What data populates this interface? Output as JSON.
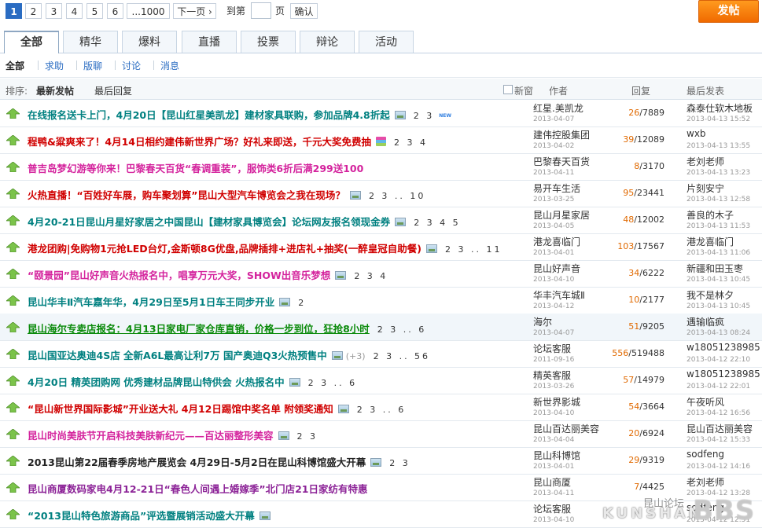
{
  "colors": {
    "accent": "#2a6cc2",
    "post_button": "#f47a0a",
    "teal": "#008080",
    "red": "#d00000",
    "pink": "#d4239d",
    "green": "#0a8a0a",
    "black": "#222222",
    "purple": "#8c2397",
    "reply_count": "#e06900"
  },
  "pagination": {
    "pages": [
      "1",
      "2",
      "3",
      "4",
      "5",
      "6",
      "...1000"
    ],
    "current": "1",
    "next_label": "下一页 ›",
    "goto_label": "到第",
    "page_suffix": "页",
    "confirm_label": "确认",
    "post_button": "发帖"
  },
  "tabs": [
    "全部",
    "精华",
    "爆料",
    "直播",
    "投票",
    "辩论",
    "活动"
  ],
  "active_tab": "全部",
  "subnav": [
    "全部",
    "求助",
    "版聊",
    "讨论",
    "消息"
  ],
  "header": {
    "sort_label": "排序:",
    "sort_latest_post": "最新发帖",
    "sort_last_reply": "最后回复",
    "new_window": "新窗",
    "author": "作者",
    "replies": "回复",
    "last_post": "最后发表"
  },
  "threads": [
    {
      "title": "在线报名送卡上门，4月20日【昆山红星美凯龙】建材家具联购，参加品牌4.8折起",
      "color": "teal",
      "img": true,
      "pages": "2 3",
      "new": "NEW",
      "author": "红星.美凯龙",
      "author_date": "2013-04-07",
      "replies": "26",
      "views": "/7889",
      "last_user": "森泰仕软木地板",
      "last_date": "2013-04-13 15:52"
    },
    {
      "title": "程鸭&粱爽来了！4月14日相约建伟新世界广场？好礼来即送，千元大奖免费抽",
      "color": "red",
      "book": true,
      "pages": "2 3 4",
      "author": "建伟控股集团",
      "author_date": "2013-04-02",
      "replies": "39",
      "views": "/12089",
      "last_user": "wxb",
      "last_date": "2013-04-13 13:55"
    },
    {
      "title": "普吉岛梦幻游等你来！巴黎春天百货“春调重装”，服饰类6折后满299送100",
      "color": "pink",
      "author": "巴黎春天百货",
      "author_date": "2013-04-11",
      "replies": "8",
      "views": "/3170",
      "last_user": "老刘老师",
      "last_date": "2013-04-13 13:23"
    },
    {
      "title": "火热直播！“百姓好车展，购车聚划算”昆山大型汽车博览会之我在现场？",
      "color": "red",
      "img": true,
      "pages": "2 3 .. 10",
      "author": "易开车生活",
      "author_date": "2013-03-25",
      "replies": "95",
      "views": "/23441",
      "last_user": "片刻安宁",
      "last_date": "2013-04-13 12:58"
    },
    {
      "title": "4月20-21日昆山月星好家居之中国昆山【建材家具博览会】论坛网友报名领现金券",
      "color": "teal",
      "img": true,
      "pages": "2 3 4 5",
      "author": "昆山月星家居",
      "author_date": "2013-04-05",
      "replies": "48",
      "views": "/12002",
      "last_user": "善良的木子",
      "last_date": "2013-04-13 11:53"
    },
    {
      "title": "港龙团购|免购物1元抢LED台灯,金斯顿8G优盘,品牌插排+进店礼+抽奖(一醉皇冠自助餐)",
      "color": "red",
      "img": true,
      "pages": "2 3 .. 11",
      "author": "港龙喜临门",
      "author_date": "2013-04-01",
      "replies": "103",
      "views": "/17567",
      "last_user": "港龙喜临门",
      "last_date": "2013-04-13 11:06"
    },
    {
      "title": "“颐景园”昆山好声音火热报名中，唱享万元大奖，SHOW出音乐梦想",
      "color": "pink",
      "img": true,
      "pages": "2 3 4",
      "author": "昆山好声音",
      "author_date": "2013-04-10",
      "replies": "34",
      "views": "/6222",
      "last_user": "新疆和田玉枣",
      "last_date": "2013-04-13 10:45"
    },
    {
      "title": "昆山华丰Ⅱ汽车嘉年华，4月29日至5月1日车王同步开业",
      "color": "teal",
      "img": true,
      "pages": "2",
      "author": "华丰汽车城Ⅱ",
      "author_date": "2013-04-12",
      "replies": "10",
      "views": "/2177",
      "last_user": "我不是林夕",
      "last_date": "2013-04-13 10:45"
    },
    {
      "title": "昆山海尔专卖店报名：4月13日家电厂家仓库直销，价格一步到位，狂抢8小时",
      "color": "green",
      "underline": true,
      "highlight": true,
      "pages": "2 3 .. 6",
      "author": "海尔",
      "author_date": "2013-04-07",
      "replies": "51",
      "views": "/9205",
      "last_user": "遇输临疯",
      "last_date": "2013-04-13 08:24"
    },
    {
      "title": "昆山国亚达奥迪4S店 全新A6L最高让利7万 国产奥迪Q3火热预售中",
      "color": "teal",
      "img": true,
      "extra": "(+3)",
      "pages": "2 3 .. 56",
      "author": "论坛客服",
      "author_date": "2011-09-16",
      "replies": "556",
      "views": "/519488",
      "last_user": "w18051238985",
      "last_date": "2013-04-12 22:10"
    },
    {
      "title": "4月20日 精英团购网 优秀建材品牌昆山特供会 火热报名中",
      "color": "teal",
      "img": true,
      "pages": "2 3 .. 6",
      "author": "精英客服",
      "author_date": "2013-03-26",
      "replies": "57",
      "views": "/14979",
      "last_user": "w18051238985",
      "last_date": "2013-04-12 22:01"
    },
    {
      "title": "“昆山新世界国际影城”开业送大礼 4月12日踢馆中奖名单 附领奖通知",
      "color": "red",
      "img": true,
      "pages": "2 3 .. 6",
      "author": "新世界影城",
      "author_date": "2013-04-10",
      "replies": "54",
      "views": "/3664",
      "last_user": "午夜听风",
      "last_date": "2013-04-12 16:56"
    },
    {
      "title": "昆山时尚美肤节开启科技美肤新纪元——百达丽整形美容",
      "color": "pink",
      "img": true,
      "pages": "2 3",
      "author": "昆山百达丽美容",
      "author_date": "2013-04-04",
      "replies": "20",
      "views": "/6924",
      "last_user": "昆山百达丽美容",
      "last_date": "2013-04-12 15:33"
    },
    {
      "title": "2013昆山第22届春季房地产展览会 4月29日-5月2日在昆山科博馆盛大开幕",
      "color": "black",
      "img": true,
      "pages": "2 3",
      "author": "昆山科博馆",
      "author_date": "2013-04-01",
      "replies": "29",
      "views": "/9319",
      "last_user": "sodfeng",
      "last_date": "2013-04-12 14:16"
    },
    {
      "title": "昆山商厦数码家电4月12-21日“春色人间遇上婚嫁季”北门店21日家纺有特惠",
      "color": "purple",
      "author": "昆山商厦",
      "author_date": "2013-04-11",
      "replies": "7",
      "views": "/4425",
      "last_user": "老刘老师",
      "last_date": "2013-04-12 13:28"
    },
    {
      "title": "“2013昆山特色旅游商品”评选暨展销活动盛大开幕",
      "color": "teal",
      "img": true,
      "author": "论坛客服",
      "author_date": "2013-04-10",
      "replies": "",
      "views": "",
      "last_user": "sodfeng",
      "last_date": "2013-04-12 12:51"
    }
  ],
  "watermark": {
    "line1": "昆山论坛",
    "line2": "KUNSHAN",
    "line3": "BBS"
  }
}
